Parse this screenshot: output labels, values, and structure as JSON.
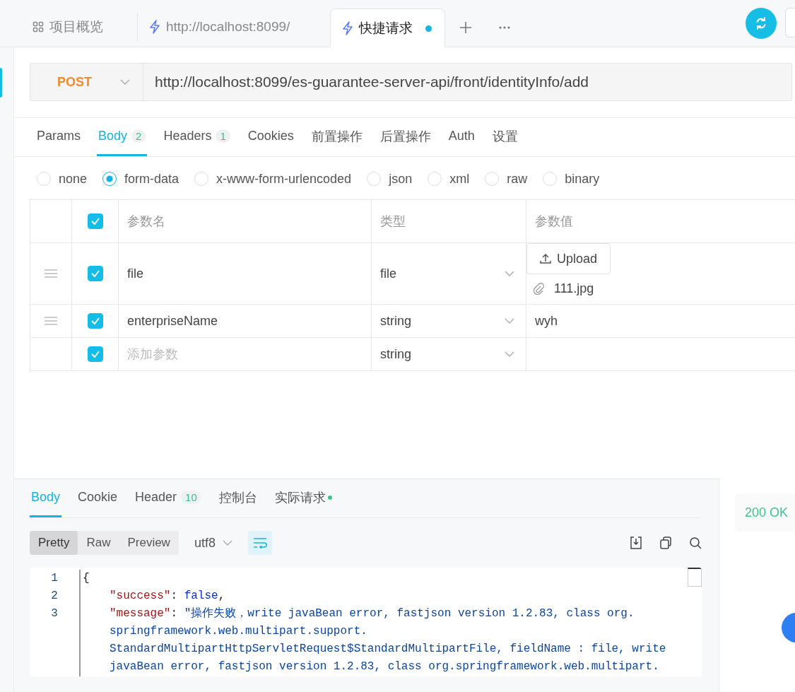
{
  "top_tabs": [
    {
      "label": "项目概览",
      "selected": false,
      "modified": false
    },
    {
      "label": "http://localhost:8099/",
      "selected": false,
      "modified": false
    },
    {
      "label": "快捷请求",
      "selected": true,
      "modified": true
    }
  ],
  "request": {
    "method": "POST",
    "url": "http://localhost:8099/es-guarantee-server-api/front/identityInfo/add"
  },
  "request_tabs": [
    {
      "label": "Params",
      "selected": false
    },
    {
      "label": "Body",
      "count": "2",
      "selected": true
    },
    {
      "label": "Headers",
      "count": "1",
      "selected": false
    },
    {
      "label": "Cookies",
      "selected": false
    },
    {
      "label": "前置操作",
      "selected": false
    },
    {
      "label": "后置操作",
      "selected": false
    },
    {
      "label": "Auth",
      "selected": false
    },
    {
      "label": "设置",
      "selected": false
    }
  ],
  "body_types": [
    {
      "label": "none",
      "selected": false
    },
    {
      "label": "form-data",
      "selected": true
    },
    {
      "label": "x-www-form-urlencoded",
      "selected": false
    },
    {
      "label": "json",
      "selected": false
    },
    {
      "label": "xml",
      "selected": false
    },
    {
      "label": "raw",
      "selected": false
    },
    {
      "label": "binary",
      "selected": false
    }
  ],
  "params_table": {
    "all_checked": true,
    "columns": [
      "参数名",
      "类型",
      "参数值"
    ],
    "rows": [
      {
        "kind": "file",
        "draggable": true,
        "checked": true,
        "name": "file",
        "type": "file",
        "upload_label": "Upload",
        "file_name": "111.jpg"
      },
      {
        "kind": "text",
        "draggable": true,
        "checked": true,
        "name": "enterpriseName",
        "type": "string",
        "value": "wyh"
      },
      {
        "kind": "new",
        "draggable": false,
        "checked": true,
        "placeholder": "添加参数",
        "type": "string"
      }
    ]
  },
  "response_tabs": [
    {
      "label": "Body",
      "selected": true,
      "indicator": false
    },
    {
      "label": "Cookie",
      "selected": false,
      "indicator": false
    },
    {
      "label": "Header",
      "count": "10",
      "selected": false,
      "indicator": false
    },
    {
      "label": "控制台",
      "selected": false,
      "indicator": false
    },
    {
      "label": "实际请求",
      "selected": false,
      "indicator": true
    }
  ],
  "view_modes": [
    {
      "label": "Pretty",
      "selected": true
    },
    {
      "label": "Raw",
      "selected": false
    },
    {
      "label": "Preview",
      "selected": false
    }
  ],
  "encoding": "utf8",
  "wrap_on": true,
  "code_lines": [
    {
      "number": "1",
      "tokens": [
        {
          "kind": "punct",
          "text": "{"
        }
      ]
    },
    {
      "number": "2",
      "tokens": [
        {
          "kind": "key",
          "text": "\"success\""
        },
        {
          "kind": "punct",
          "text": ": "
        },
        {
          "kind": "bool",
          "text": "false"
        },
        {
          "kind": "punct",
          "text": ","
        }
      ]
    },
    {
      "number": "3",
      "tokens": [
        {
          "kind": "key",
          "text": "\"message\""
        },
        {
          "kind": "punct",
          "text": ": "
        },
        {
          "kind": "string",
          "text": "\"操作失败，write javaBean error, fastjson version 1.2.83, class org."
        }
      ]
    },
    {
      "tokens": [
        {
          "kind": "string",
          "text": "springframework.web.multipart.support."
        }
      ]
    },
    {
      "tokens": [
        {
          "kind": "string",
          "text": "StandardMultipartHttpServletRequest$StandardMultipartFile, fieldName : file, write"
        }
      ]
    },
    {
      "tokens": [
        {
          "kind": "string",
          "text": "javaBean error, fastjson version 1.2.83, class org.springframework.web.multipart."
        }
      ]
    }
  ],
  "status": "200 OK"
}
